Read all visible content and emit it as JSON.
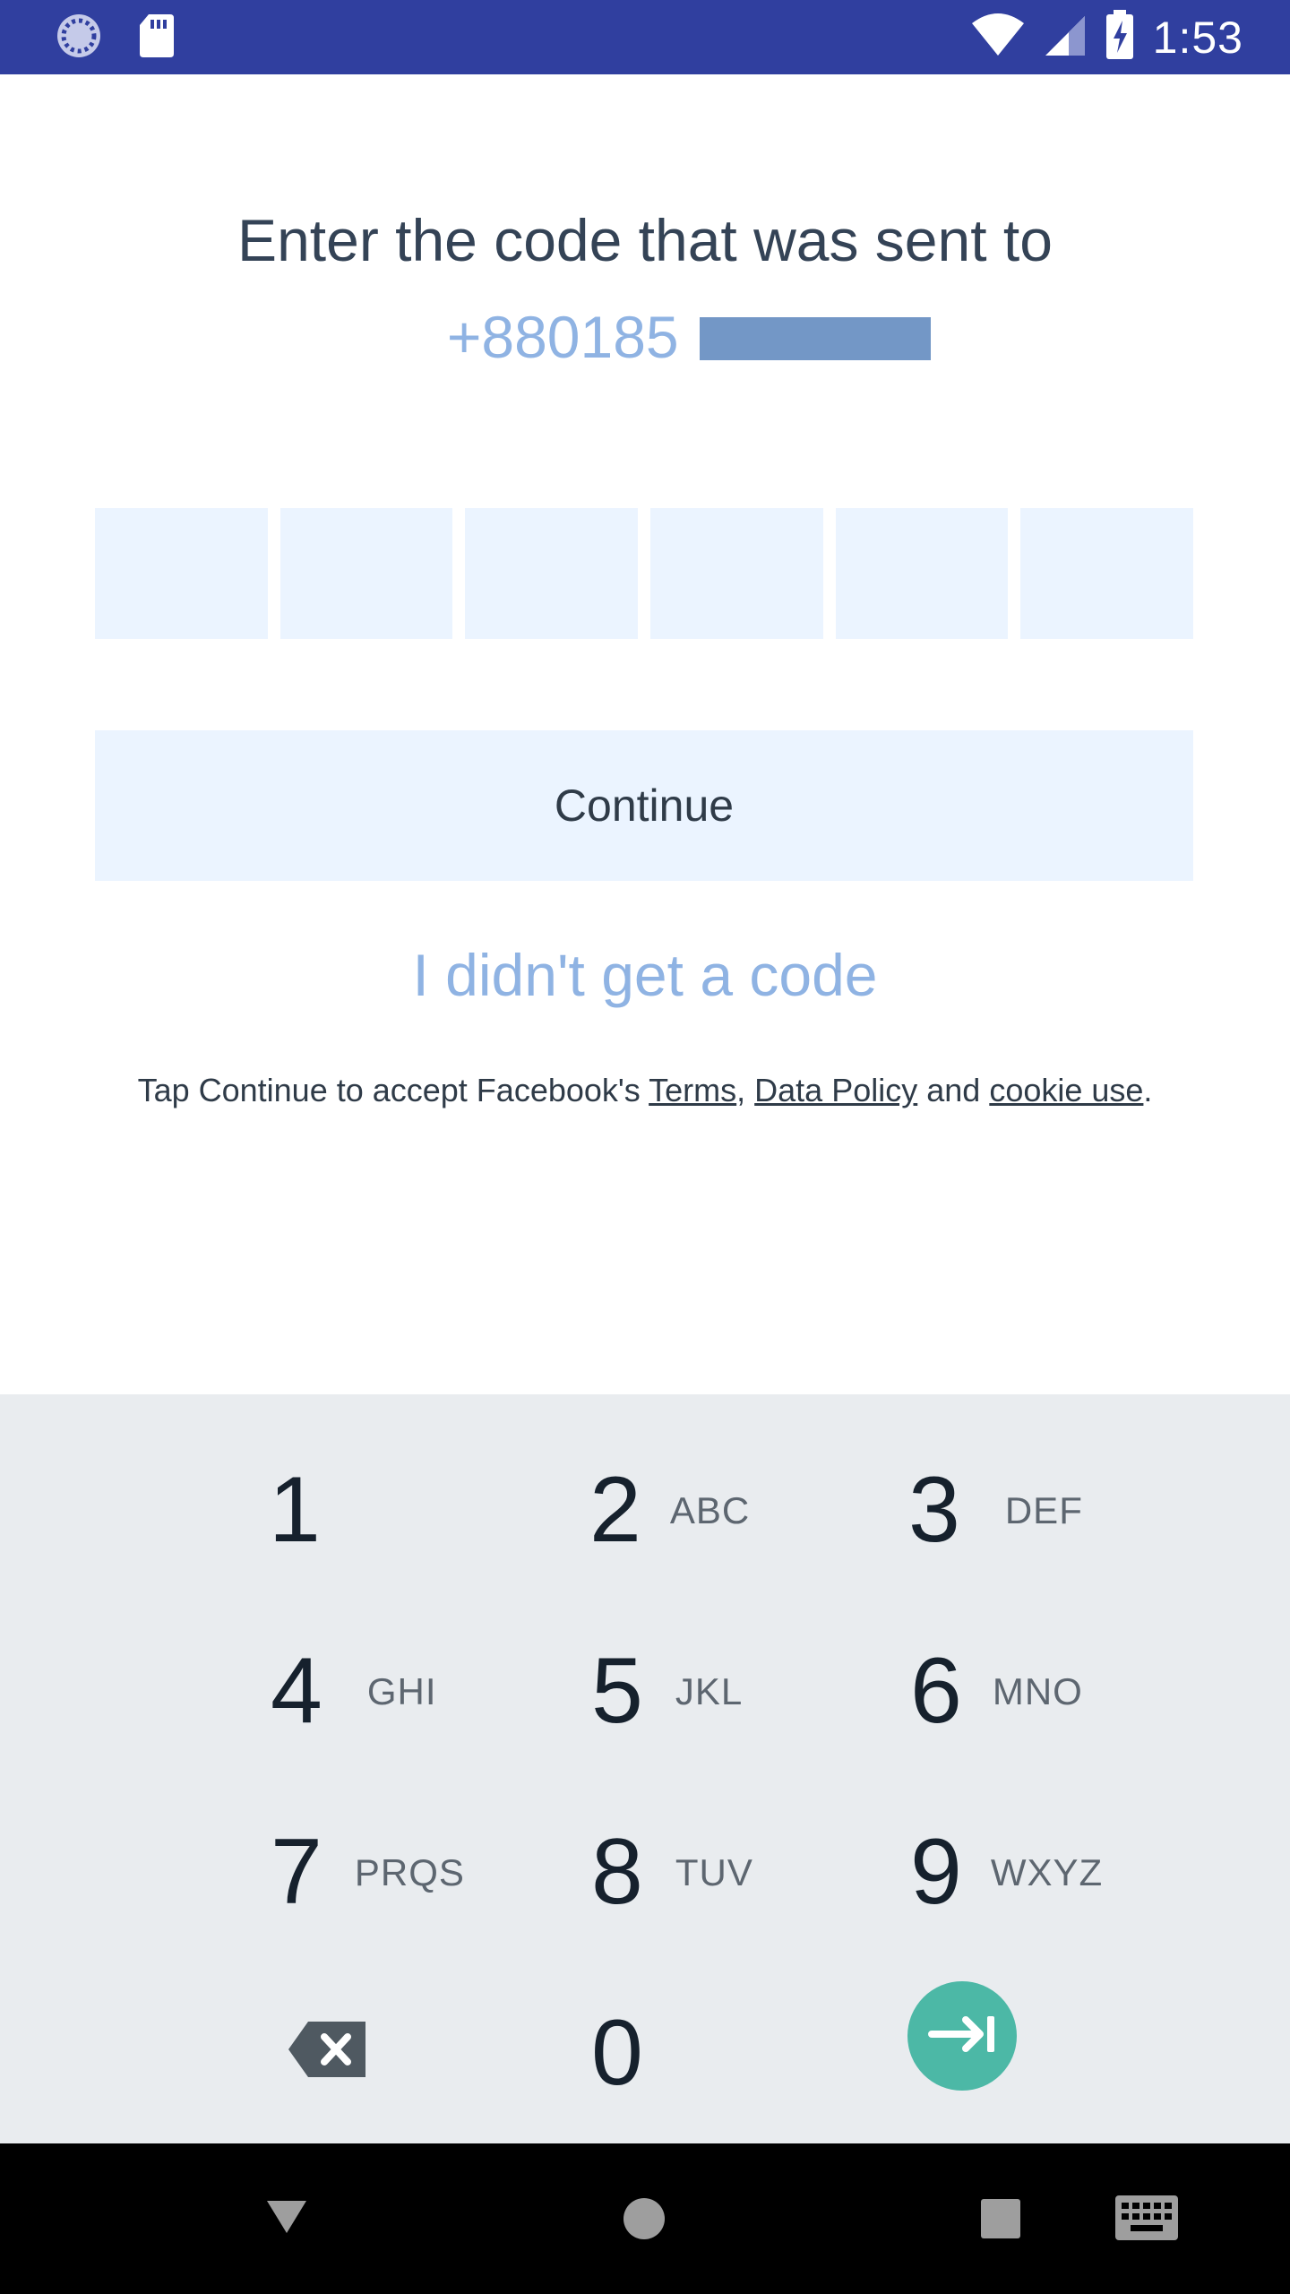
{
  "status_bar": {
    "time": "1:53",
    "icons": [
      "loading-icon",
      "sd-card-icon",
      "wifi-icon",
      "signal-icon",
      "battery-charging-icon"
    ]
  },
  "verification": {
    "title": "Enter the code that was sent to",
    "phone": "+880185",
    "code_digits": [
      "",
      "",
      "",
      "",
      "",
      ""
    ],
    "continue_label": "Continue",
    "no_code_label": "I didn't get a code",
    "terms": {
      "prefix": "Tap Continue to accept Facebook's ",
      "terms_link": "Terms",
      "sep": ", ",
      "data_policy_link": "Data Policy",
      "and": " and ",
      "cookie_link": "cookie use",
      "suffix": "."
    }
  },
  "keypad": {
    "keys": [
      {
        "num": "1",
        "letters": ""
      },
      {
        "num": "2",
        "letters": "ABC"
      },
      {
        "num": "3",
        "letters": "DEF"
      },
      {
        "num": "4",
        "letters": "GHI"
      },
      {
        "num": "5",
        "letters": "JKL"
      },
      {
        "num": "6",
        "letters": "MNO"
      },
      {
        "num": "7",
        "letters": "PRQS"
      },
      {
        "num": "8",
        "letters": "TUV"
      },
      {
        "num": "9",
        "letters": "WXYZ"
      },
      {
        "num": "0",
        "letters": ""
      }
    ]
  },
  "colors": {
    "status_bar": "#303f9f",
    "accent_link": "#8fb3e3",
    "input_bg": "#ebf4ff",
    "keypad_bg": "#e9ecef",
    "go_button": "#4cb8a6"
  }
}
